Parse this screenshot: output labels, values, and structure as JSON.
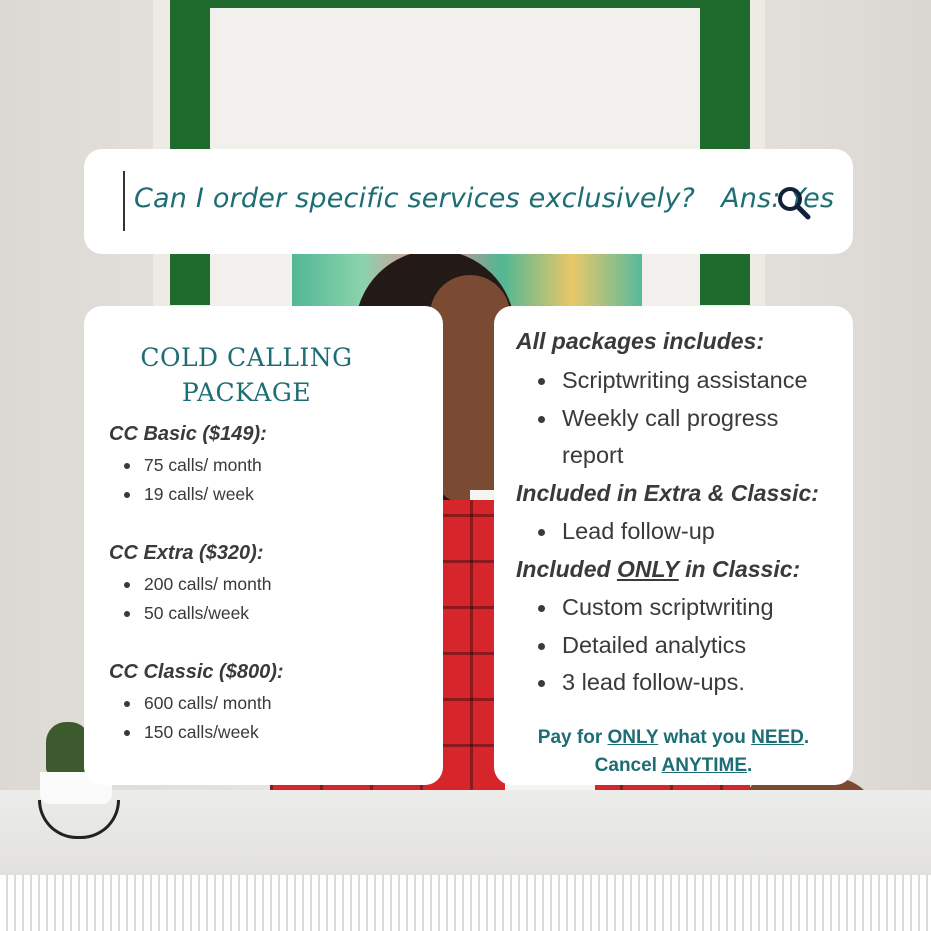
{
  "search": {
    "question": "Can I order specific services exclusively?",
    "answer": "Ans: Yes",
    "icon": "search-icon"
  },
  "cold_calling": {
    "title_line1": "COLD CALLING",
    "title_line2": "PACKAGE",
    "packages": [
      {
        "name": "CC Basic ($149):",
        "items": [
          "75 calls/ month",
          "19 calls/ week"
        ]
      },
      {
        "name": "CC Extra ($320):",
        "items": [
          "200 calls/ month",
          "50 calls/week"
        ]
      },
      {
        "name": "CC Classic ($800):",
        "items": [
          "600 calls/ month",
          "150 calls/week"
        ]
      }
    ]
  },
  "inclusions": {
    "all_heading": "All packages includes:",
    "all_items": [
      "Scriptwriting assistance",
      "Weekly call progress report"
    ],
    "extra_heading": "Included in Extra & Classic:",
    "extra_items": [
      "Lead follow-up"
    ],
    "classic_heading_pre": "Included ",
    "classic_heading_emph": "ONLY",
    "classic_heading_post": " in Classic:",
    "classic_items": [
      "Custom scriptwriting",
      "Detailed analytics",
      "3 lead follow-ups."
    ],
    "footer": {
      "p1": "Pay for ",
      "only": "ONLY",
      "p2": " what you ",
      "need": "NEED",
      "p3": ".",
      "p4": "Cancel ",
      "anytime": "ANYTIME",
      "p5": "."
    }
  },
  "colors": {
    "accent_teal": "#1d6d74",
    "text_dark": "#3a3a3a",
    "card_bg": "#ffffff"
  }
}
